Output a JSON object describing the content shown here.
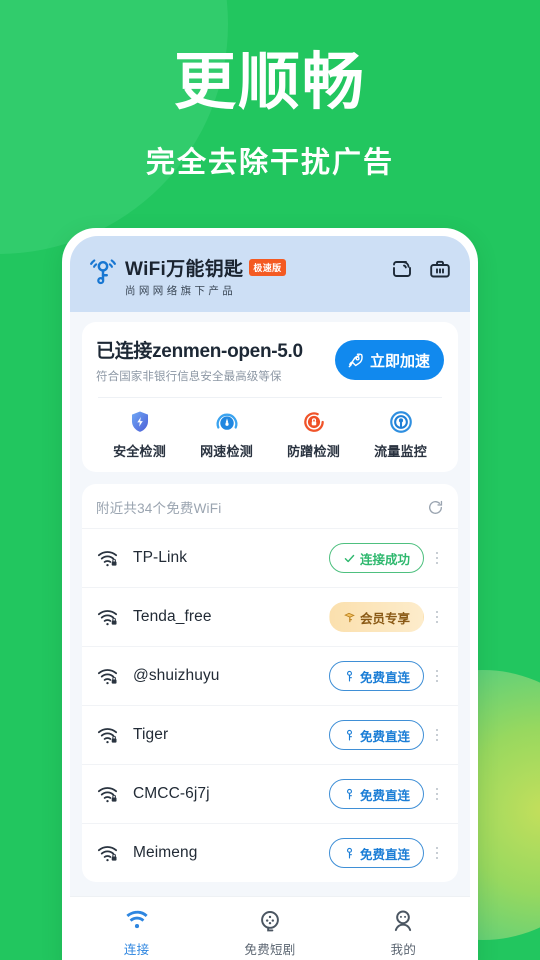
{
  "hero": {
    "title": "更顺畅",
    "subtitle": "完全去除干扰广告"
  },
  "colors": {
    "background_green": "#22c65f",
    "accent_blue": "#1189ee",
    "success_green": "#2fb86e",
    "vip_gold": "#8a5a16",
    "badge_orange": "#f45a22",
    "header_blue": "#cddff5"
  },
  "app": {
    "name": "WiFi万能钥匙",
    "badge": "极速版",
    "slogan": "尚网网络旗下产品",
    "header_icons": [
      {
        "name": "screen-cast-icon"
      },
      {
        "name": "toolbox-icon"
      }
    ]
  },
  "connection": {
    "title": "已连接zenmen-open-5.0",
    "subtitle": "符合国家非银行信息安全最高级等保",
    "accelerate_label": "立即加速",
    "accelerate_icon": "rocket-icon"
  },
  "features": [
    {
      "label": "安全检测",
      "icon": "shield-icon"
    },
    {
      "label": "网速检测",
      "icon": "speed-gauge-icon"
    },
    {
      "label": "防蹭检测",
      "icon": "anti-leech-icon"
    },
    {
      "label": "流量监控",
      "icon": "traffic-radar-icon"
    }
  ],
  "wifi_list": {
    "count_label": "附近共34个免费WiFi",
    "refresh_icon": "refresh-icon",
    "rows": [
      {
        "name": "TP-Link",
        "action": "连接成功",
        "action_type": "success",
        "icon": "wifi-lock-icon",
        "action_icon": "check-icon"
      },
      {
        "name": "Tenda_free",
        "action": "会员专享",
        "action_type": "vip",
        "icon": "wifi-lock-icon",
        "action_icon": "vip-key-icon"
      },
      {
        "name": "@shuizhuyu",
        "action": "免费直连",
        "action_type": "free",
        "icon": "wifi-lock-icon",
        "action_icon": "key-icon"
      },
      {
        "name": "Tiger",
        "action": "免费直连",
        "action_type": "free",
        "icon": "wifi-lock-icon",
        "action_icon": "key-icon"
      },
      {
        "name": "CMCC-6j7j",
        "action": "免费直连",
        "action_type": "free",
        "icon": "wifi-lock-icon",
        "action_icon": "key-icon"
      },
      {
        "name": "Meimeng",
        "action": "免费直连",
        "action_type": "free",
        "icon": "wifi-lock-icon",
        "action_icon": "key-icon"
      }
    ]
  },
  "bottom_nav": {
    "items": [
      {
        "label": "连接",
        "icon": "wifi-icon",
        "active": true
      },
      {
        "label": "免费短剧",
        "icon": "film-reel-icon",
        "active": false
      },
      {
        "label": "我的",
        "icon": "person-icon",
        "active": false
      }
    ]
  }
}
